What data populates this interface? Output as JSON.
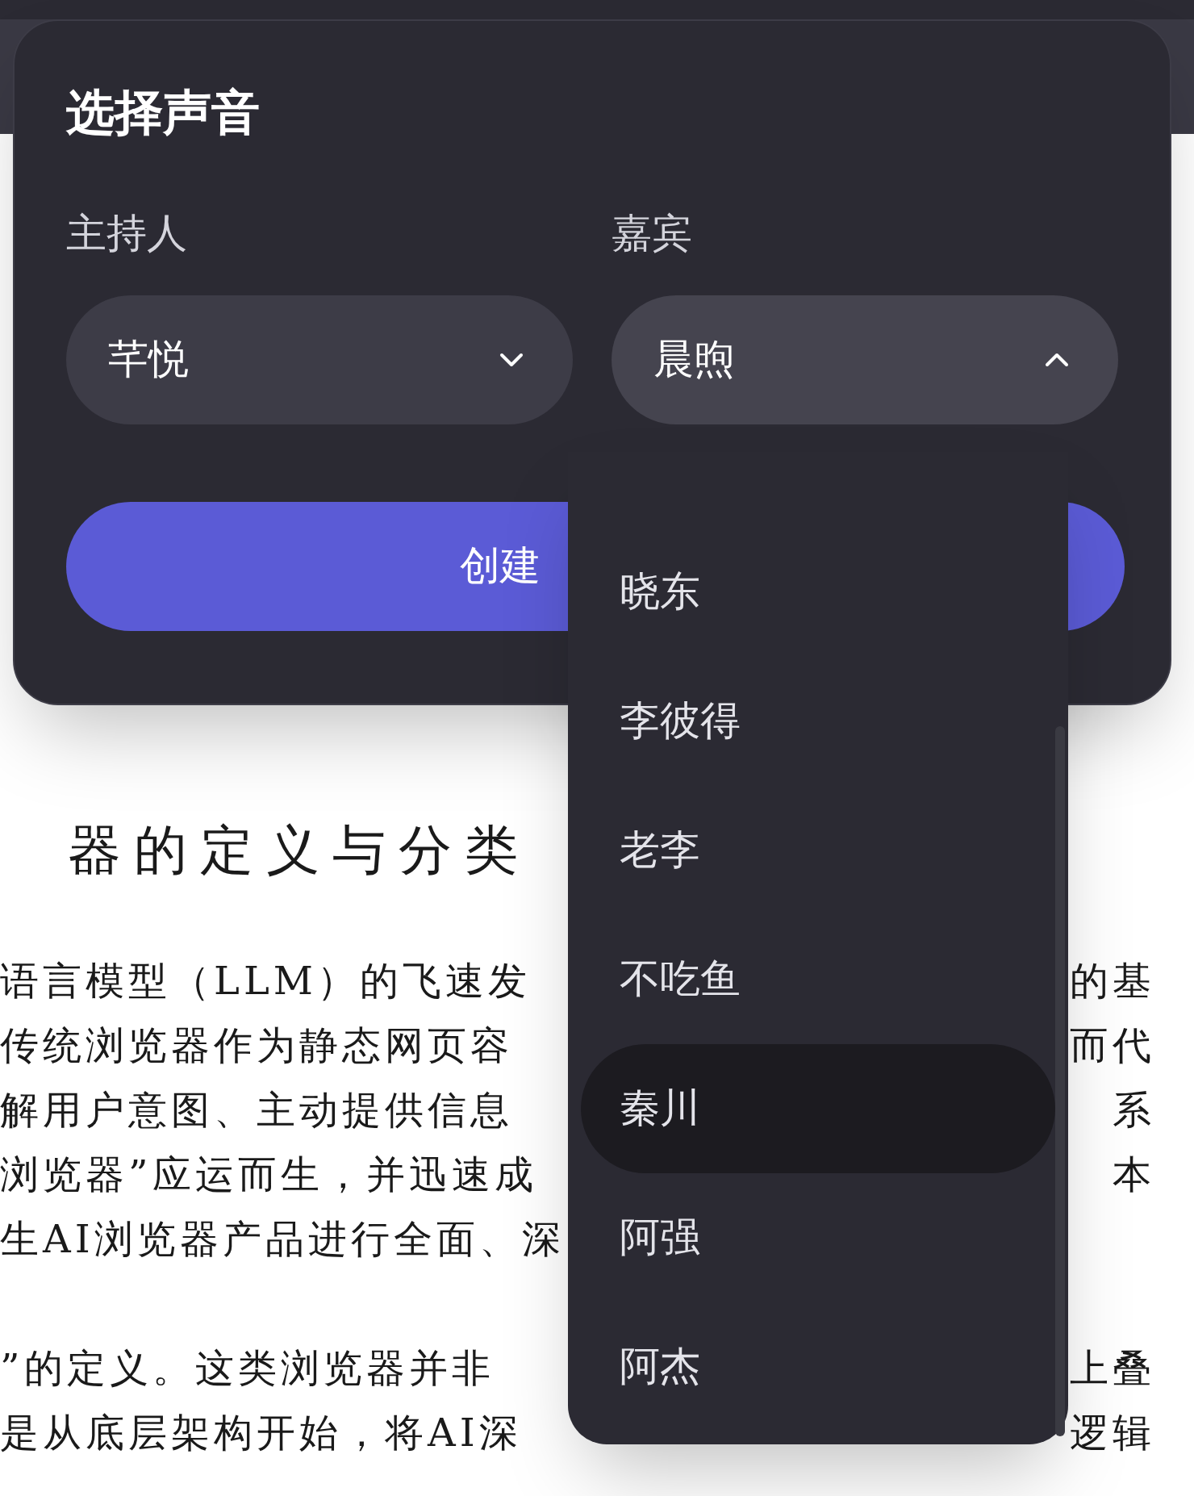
{
  "document": {
    "heading": "器的定义与分类",
    "paragraphs": [
      [
        {
          "left": "语言模型（LLM）的飞速发",
          "right": "的基"
        },
        {
          "left": "传统浏览器作为静态网页容",
          "right": "而代"
        },
        {
          "left": "解用户意图、主动提供信息",
          "right": "系"
        },
        {
          "left": "浏览器”应运而生，并迅速成",
          "right": "本"
        },
        {
          "left": "生AI浏览器产品进行全面、深"
        }
      ],
      [
        {
          "left": "”的定义。这类浏览器并非",
          "right": "上叠"
        },
        {
          "left": "是从底层架构开始，将AI深",
          "right": "逻辑"
        }
      ]
    ]
  },
  "dialog": {
    "title": "选择声音",
    "selects": [
      {
        "label": "主持人",
        "value": "芊悦",
        "expanded": false
      },
      {
        "label": "嘉宾",
        "value": "晨煦",
        "expanded": true
      }
    ],
    "create_button": "创建"
  },
  "dropdown": {
    "options": [
      {
        "label": "晓东",
        "highlighted": false
      },
      {
        "label": "李彼得",
        "highlighted": false
      },
      {
        "label": "老李",
        "highlighted": false
      },
      {
        "label": "不吃鱼",
        "highlighted": false
      },
      {
        "label": "秦川",
        "highlighted": true
      },
      {
        "label": "阿强",
        "highlighted": false
      },
      {
        "label": "阿杰",
        "highlighted": false
      }
    ]
  }
}
